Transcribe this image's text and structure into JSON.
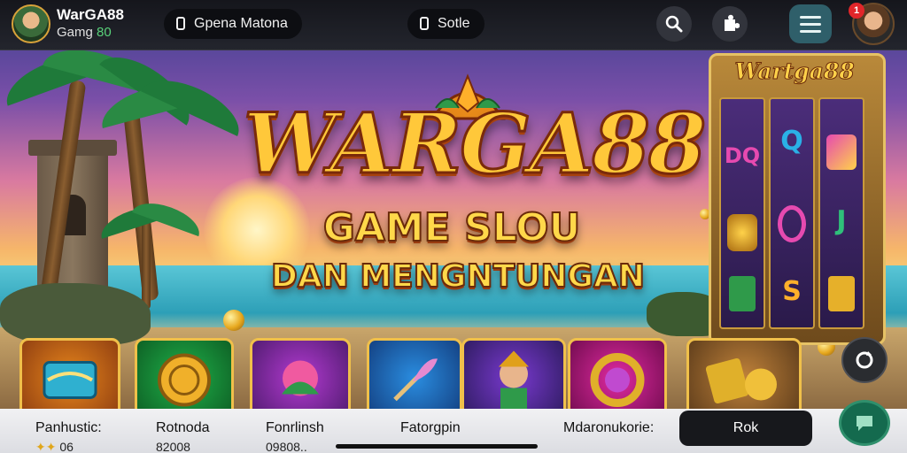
{
  "topbar": {
    "brand_title": "WarGA88",
    "brand_sub_prefix": "Gamg ",
    "brand_sub_highlight": "80",
    "pill_left_label": "Gpena Matona",
    "pill_center_label": "Sotle",
    "notification_count": "1",
    "icons": [
      "search-icon",
      "puzzle-icon",
      "menu-icon",
      "avatar"
    ]
  },
  "hero": {
    "title": "WARGA88",
    "line2": "GAME SLOU",
    "line3": "DAN MENGNTUNGAN"
  },
  "slot_machine": {
    "title": "Wartga88",
    "symbols": [
      "DQ",
      "Q",
      "S",
      "J"
    ]
  },
  "tiles": [
    {
      "name": "tile-scroll",
      "colors": [
        "#e7861c",
        "#8a3a10"
      ]
    },
    {
      "name": "tile-coin",
      "colors": [
        "#1fb14a",
        "#0d5a22"
      ]
    },
    {
      "name": "tile-flower",
      "colors": [
        "#b23ad0",
        "#4a1a6a"
      ]
    },
    {
      "name": "tile-feather",
      "colors": [
        "#2a8de0",
        "#123a7a"
      ]
    },
    {
      "name": "tile-hero",
      "colors": [
        "#7a3ad0",
        "#2a1a5a"
      ]
    },
    {
      "name": "tile-ring",
      "colors": [
        "#e02aa0",
        "#6a0a4a"
      ]
    },
    {
      "name": "tile-treasure",
      "colors": [
        "#c0823a",
        "#5a3a1a"
      ]
    }
  ],
  "bottombar": {
    "stats": [
      {
        "label": "Panhustic:",
        "value": "06"
      },
      {
        "label": "Rotnoda",
        "value": "82008"
      },
      {
        "label": "Fonrlinsh",
        "value": "09808.."
      },
      {
        "label": "Fatorgpin",
        "value": ""
      },
      {
        "label": "Mdaronukorie:",
        "value": ""
      }
    ],
    "stars": "✦✦",
    "rok_label": "Rok"
  }
}
